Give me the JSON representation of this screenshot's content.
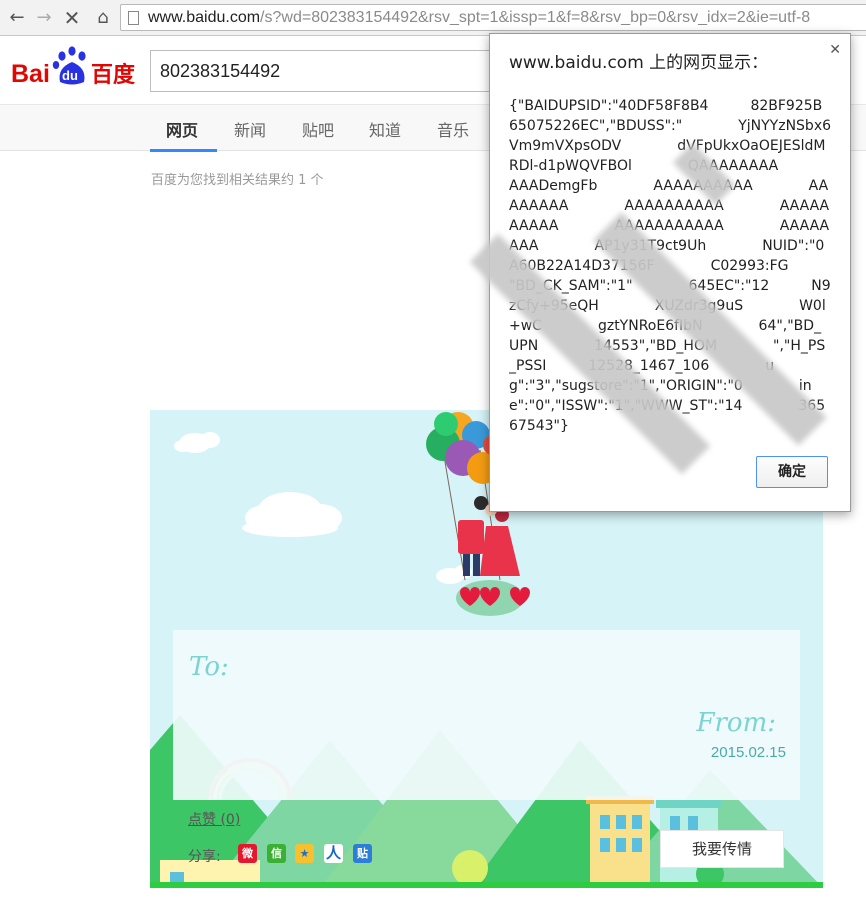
{
  "browser": {
    "url_host": "www.baidu.com",
    "url_rest": "/s?wd=802383154492&rsv_spt=1&issp=1&f=8&rsv_bp=0&rsv_idx=2&ie=utf-8"
  },
  "header": {
    "logo_text_bai": "Bai",
    "logo_text_du": "du",
    "logo_text_cn": "百度",
    "search_value": "802383154492"
  },
  "tabs": [
    "网页",
    "新闻",
    "贴吧",
    "知道",
    "音乐"
  ],
  "result_count": "百度为您找到相关结果约 1 个",
  "card": {
    "to_label": "To:",
    "from_label": "From:",
    "date": "2015.02.15",
    "like_label": "点赞 (0)",
    "share_label": "分享:",
    "share_icons": [
      "weibo-icon",
      "wechat-icon",
      "qzone-icon",
      "renren-icon",
      "tieba-icon"
    ],
    "send_button": "我要传情"
  },
  "dialog": {
    "title": "www.baidu.com 上的网页显示：",
    "message": "{\"BAIDUPSID\":\"40DF58F8B4　　　82BF925B65075226EC\",\"BDUSS\":\"　　　　YjNYYzNSbx6Vm9mVXpsODV　　　　dVFpUkxOaOEJESldMRDl-d1pWQVFBOl　　　　QAAAAAAAA　　　　AAADemgFb　　　　AAAAAAAAAA　　　　AAAAAAAA　　　　AAAAAAAAAA　　　　AAAAAAAAAA　　　　AAAAAAAAAAA　　　　AAAAAAAA　　　　AP1y31T9ct9Uh　　　　NUID\":\"0　　　　A60B22A14D37156F　　　　C02993:FG　　　　\"BD_CK_SAM\":\"1\"　　　　645EC\":\"12　　　N9zCfy+95eQH　　　　XUZdr3g9uS　　　　W0l+wC　　　　gztYNRoE6fIbN　　　　64\",\"BD_UPN　　　　14553\",\"BD_HOM　　　　\",\"H_PS_PSSI　　　12528_1467_106　　　　ug\":\"3\",\"sugstore\":\"1\",\"ORIGIN\":\"0　　　　ine\":\"0\",\"ISSW\":\"1\",\"WWW_ST\":\"14　　　　36567543\"}",
    "ok_button": "确定"
  },
  "colors": {
    "baidu_red": "#e10602",
    "baidu_blue": "#2932e1",
    "tab_accent": "#3388ff",
    "grass": "#2ecc40"
  }
}
